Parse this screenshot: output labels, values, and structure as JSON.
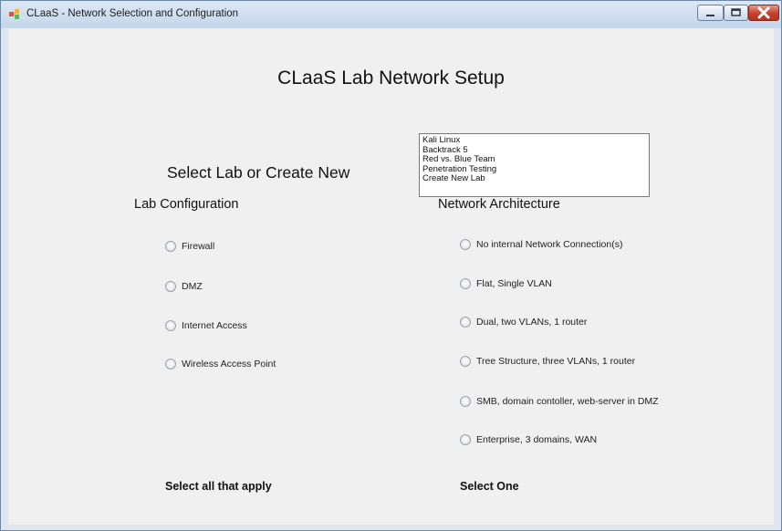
{
  "window": {
    "title": "CLaaS - Network Selection and Configuration",
    "icon": "app-icon"
  },
  "heading": "CLaaS Lab Network Setup",
  "lab_select": {
    "label": "Select Lab or Create New",
    "items": [
      "Kali Linux",
      "Backtrack 5",
      "Red vs. Blue Team",
      "Penetration Testing",
      "Create New Lab"
    ]
  },
  "lab_config": {
    "title": "Lab Configuration",
    "options": [
      "Firewall",
      "DMZ",
      "Internet Access",
      "Wireless Access Point"
    ],
    "footer": "Select all that apply"
  },
  "network": {
    "title": "Network Architecture",
    "options": [
      "No internal Network Connection(s)",
      "Flat, Single VLAN",
      "Dual, two VLANs, 1 router",
      "Tree Structure, three VLANs, 1 router",
      "SMB, domain contoller, web-server in DMZ",
      "Enterprise, 3 domains, WAN"
    ],
    "footer": "Select One"
  },
  "colors": {
    "title_bar": "#c9daee",
    "client_bg": "#f0f0f0",
    "close_button": "#c4412a"
  }
}
